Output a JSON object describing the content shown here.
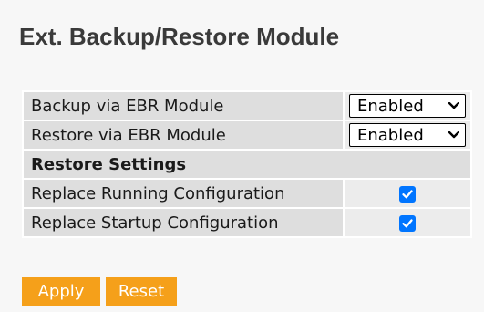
{
  "page": {
    "title": "Ext. Backup/Restore Module"
  },
  "settings": {
    "backup": {
      "label": "Backup via EBR Module",
      "value": "Enabled"
    },
    "restore": {
      "label": "Restore via EBR Module",
      "value": "Enabled"
    },
    "section_label": "Restore Settings",
    "replace_running": {
      "label": "Replace Running Configuration",
      "checked": true
    },
    "replace_startup": {
      "label": "Replace Startup Configuration",
      "checked": true
    }
  },
  "buttons": {
    "apply": "Apply",
    "reset": "Reset"
  },
  "colors": {
    "button_bg": "#f5a01a",
    "checkbox_checked": "#0075ff",
    "label_cell_bg": "#dedede",
    "control_cell_bg": "#ececec"
  },
  "icons": {
    "select_arrow": "chevron-down-icon",
    "checkbox_mark": "checkmark-icon"
  }
}
